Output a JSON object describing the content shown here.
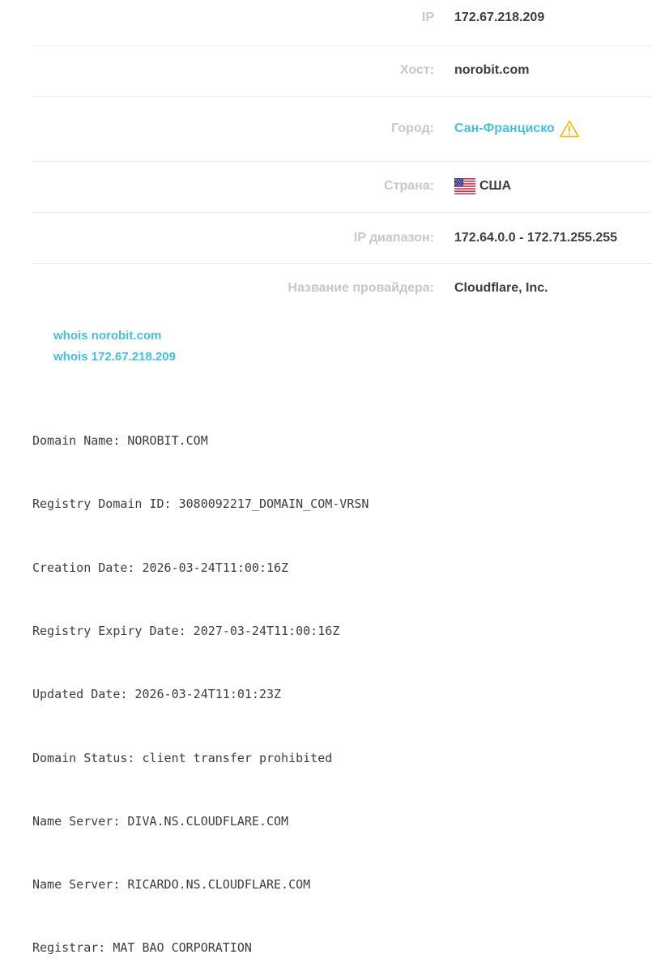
{
  "info": {
    "ip": {
      "label": "IP",
      "value": "172.67.218.209"
    },
    "host": {
      "label": "Хост:",
      "value": "norobit.com"
    },
    "city": {
      "label": "Город:",
      "value": "Сан-Франциско"
    },
    "country": {
      "label": "Страна:",
      "value": "США",
      "flag_icon": "us-flag-icon"
    },
    "ip_range": {
      "label": "IP диапазон:",
      "value": "172.64.0.0 - 172.71.255.255"
    },
    "provider": {
      "label": "Название провайдера:",
      "value": "Cloudflare, Inc."
    }
  },
  "links": {
    "whois_domain": "whois norobit.com",
    "whois_ip": "whois 172.67.218.209"
  },
  "whois_lines": [
    "Domain Name: NOROBIT.COM",
    "Registry Domain ID: 3080092217_DOMAIN_COM-VRSN",
    "Creation Date: 2026-03-24T11:00:16Z",
    "Registry Expiry Date: 2027-03-24T11:00:16Z",
    "Updated Date: 2026-03-24T11:01:23Z",
    "Domain Status: client transfer prohibited",
    "Name Server: DIVA.NS.CLOUDFLARE.COM",
    "Name Server: RICARDO.NS.CLOUDFLARE.COM",
    "Registrar: MAT BAO CORPORATION"
  ],
  "colors": {
    "label": "#c4c7cc",
    "value": "#3a3d42",
    "link": "#46bfe0",
    "warning": "#f0c020",
    "divider": "#e9ecef"
  }
}
